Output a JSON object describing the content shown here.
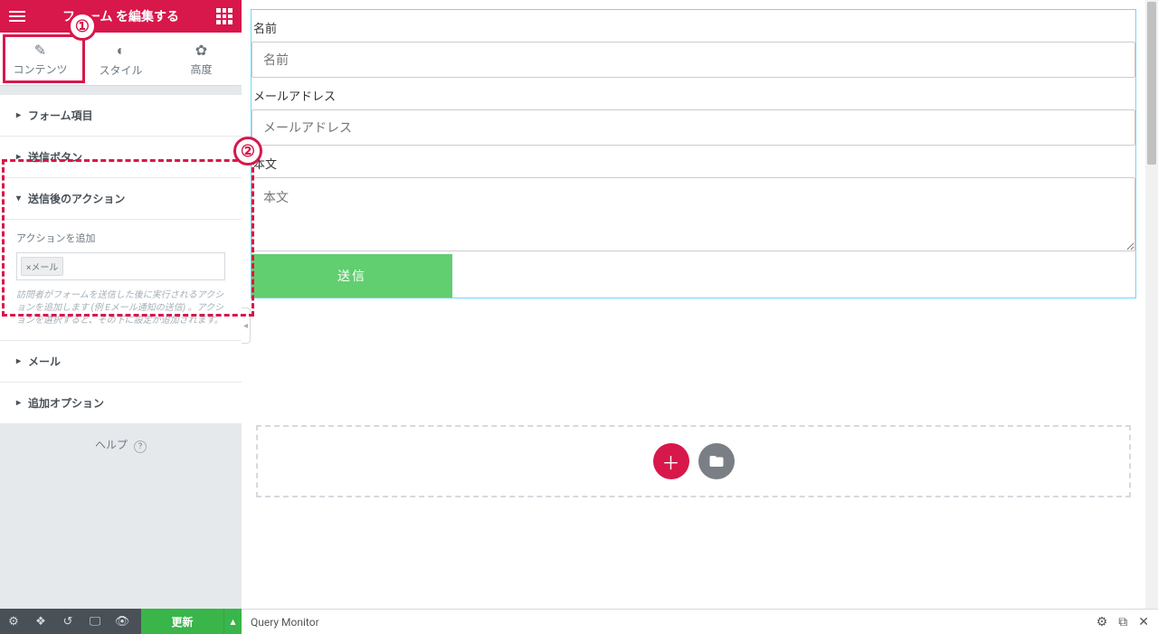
{
  "sidebar": {
    "title": "フォーム を編集する",
    "tabs": {
      "content": "コンテンツ",
      "style": "スタイル",
      "advanced": "高度"
    },
    "sections": {
      "form_fields": "フォーム項目",
      "submit_button": "送信ボタン",
      "after_submit": "送信後のアクション",
      "add_action_label": "アクションを追加",
      "action_tag": "メール",
      "hint": "訪問者がフォームを送信した後に実行されるアクションを追加します (例 Eメール通知の送信) 。アクションを選択すると、その下に設定が追加されます。",
      "email": "メール",
      "additional": "追加オプション"
    },
    "help": "ヘルプ",
    "footer": {
      "update": "更新"
    }
  },
  "form": {
    "name_label": "名前",
    "name_placeholder": "名前",
    "email_label": "メールアドレス",
    "email_placeholder": "メールアドレス",
    "body_label": "本文",
    "body_placeholder": "本文",
    "submit": "送信"
  },
  "bottombar": {
    "query_monitor": "Query Monitor"
  },
  "annotations": {
    "b1": "①",
    "b2": "②"
  }
}
